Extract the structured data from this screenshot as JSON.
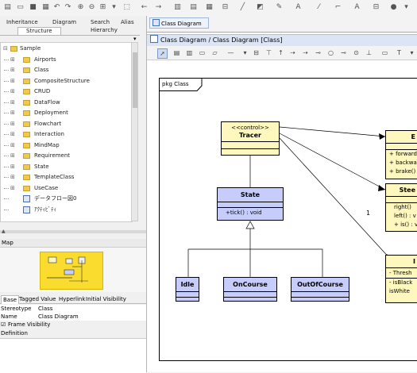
{
  "tree_tabs_row1": [
    "Inheritance",
    "Diagram",
    "Search",
    "Alias"
  ],
  "tree_tabs_row2": [
    "Structure",
    "Hierarchy"
  ],
  "tree": [
    {
      "label": "Sample",
      "level": 0,
      "icon": "folder"
    },
    {
      "label": "Airports",
      "level": 1,
      "icon": "folder"
    },
    {
      "label": "Class",
      "level": 1,
      "icon": "folder"
    },
    {
      "label": "CompositeStructure",
      "level": 1,
      "icon": "folder"
    },
    {
      "label": "CRUD",
      "level": 1,
      "icon": "folder"
    },
    {
      "label": "DataFlow",
      "level": 1,
      "icon": "folder"
    },
    {
      "label": "Deployment",
      "level": 1,
      "icon": "folder"
    },
    {
      "label": "Flowchart",
      "level": 1,
      "icon": "folder"
    },
    {
      "label": "Interaction",
      "level": 1,
      "icon": "folder"
    },
    {
      "label": "MindMap",
      "level": 1,
      "icon": "folder"
    },
    {
      "label": "Requirement",
      "level": 1,
      "icon": "folder"
    },
    {
      "label": "State",
      "level": 1,
      "icon": "folder"
    },
    {
      "label": "TemplateClass",
      "level": 1,
      "icon": "folder"
    },
    {
      "label": "UseCase",
      "level": 1,
      "icon": "folder"
    },
    {
      "label": "データフロー図0",
      "level": 1,
      "icon": "diagram"
    },
    {
      "label": "ｱｸﾃｨﾋﾞﾃｨ",
      "level": 1,
      "icon": "diagram"
    }
  ],
  "zoom_label": "Map",
  "spec_tabs": [
    "Base",
    "Tagged Value",
    "Hyperlink",
    "Initial Visibility"
  ],
  "props": [
    {
      "k": "Stereotype",
      "v": "Class"
    },
    {
      "k": "Name",
      "v": "Class Diagram"
    },
    {
      "k": "",
      "v": "Frame Visibility"
    },
    {
      "k": "Definition",
      "v": ""
    }
  ],
  "doc_tab": "Class Diagram",
  "breadcrumb": "Class Diagram / Class Diagram [Class]",
  "frame_label": "pkg Class",
  "classes": {
    "tracer": {
      "stereo": "<<control>>",
      "name": "Tracer"
    },
    "state": {
      "name": "State",
      "op": "+tick() : void"
    },
    "idle": {
      "name": "Idle"
    },
    "oncourse": {
      "name": "OnCourse"
    },
    "offcourse": {
      "name": "OutOfCourse"
    },
    "r1": {
      "name": "E",
      "ops": [
        "+ forward(",
        "+ backwar",
        "+ brake()"
      ]
    },
    "r2": {
      "name": "Stee",
      "ops": [
        "right()",
        "left() : v",
        "+ is() : vo"
      ]
    },
    "r3": {
      "name": "I",
      "attr": "- Thresh",
      "ops": [
        "- isBlack",
        "isWhite"
      ]
    }
  },
  "multiplicity": "1",
  "colors": {
    "tracer_fill": "#fff8be",
    "state_fill": "#c6cdfb",
    "thumb": "#f9dc2e"
  }
}
